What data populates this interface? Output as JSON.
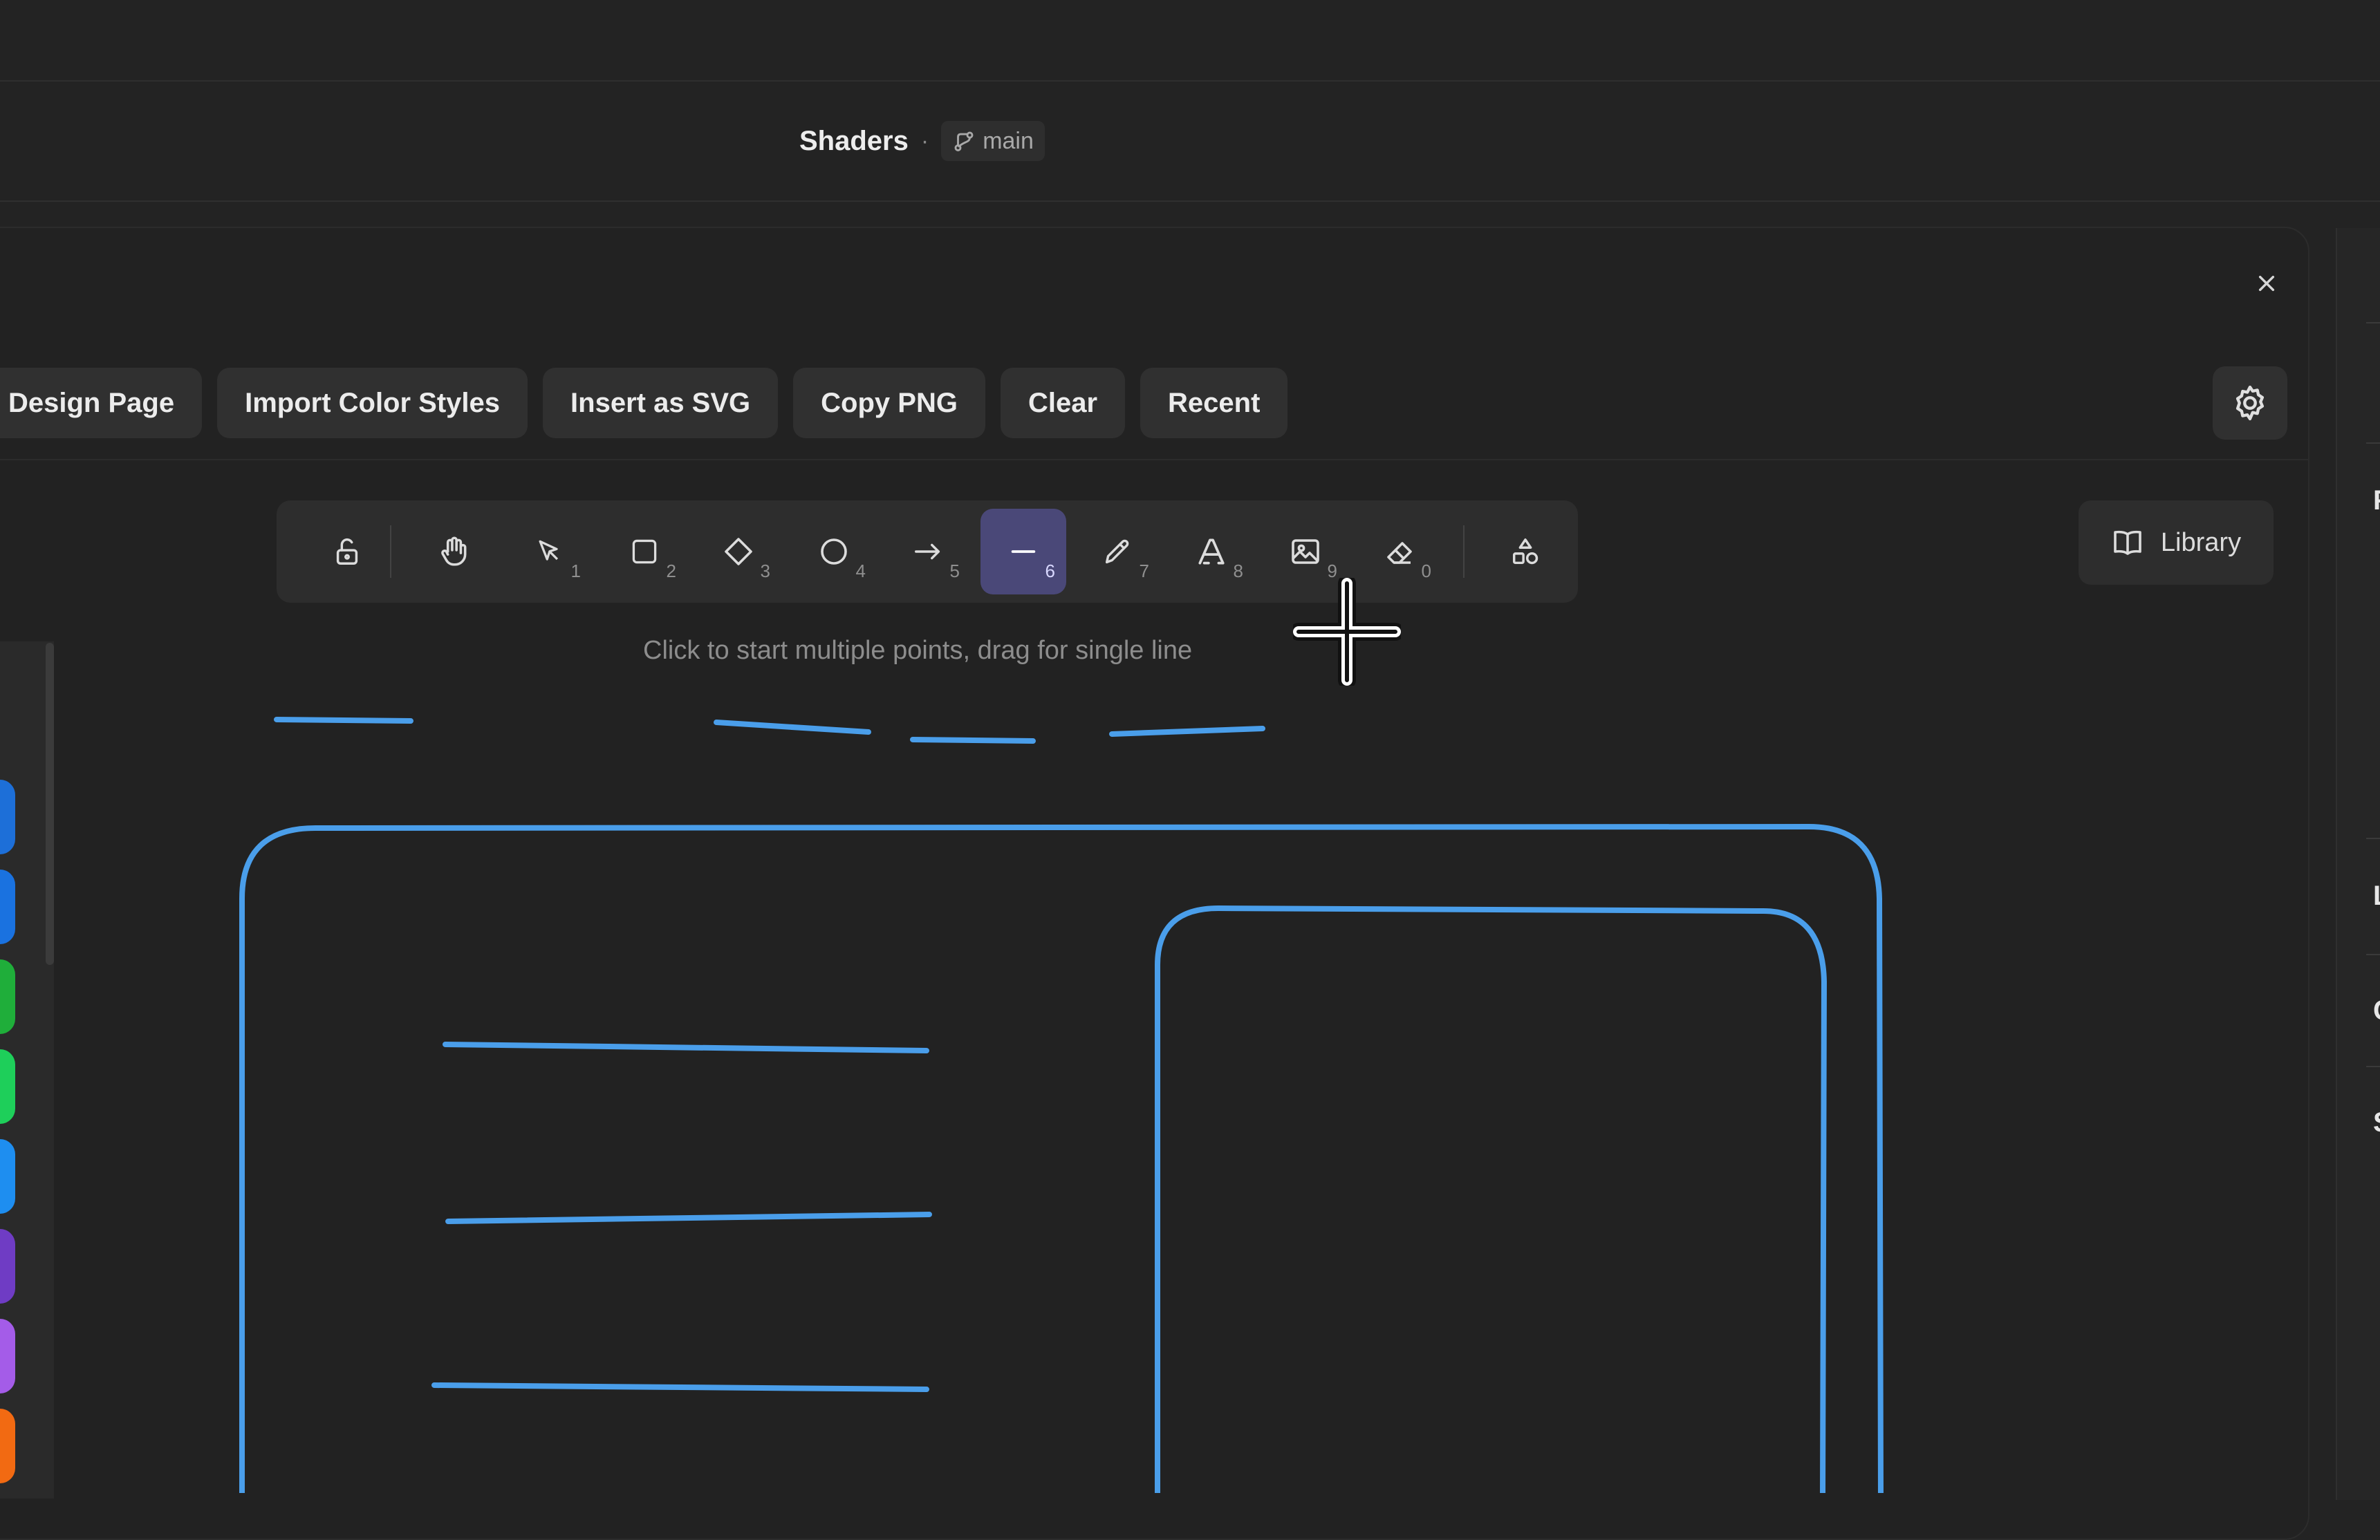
{
  "header": {
    "project_name": "Shaders",
    "separator": "·",
    "branch": "main"
  },
  "actions": [
    "Design Page",
    "Import Color Styles",
    "Insert as SVG",
    "Copy PNG",
    "Clear",
    "Recent"
  ],
  "toolbar": {
    "active_tool": "line",
    "tools": [
      {
        "name": "lock",
        "key": ""
      },
      {
        "name": "hand",
        "key": ""
      },
      {
        "name": "select",
        "key": "1"
      },
      {
        "name": "rectangle",
        "key": "2"
      },
      {
        "name": "diamond",
        "key": "3"
      },
      {
        "name": "ellipse",
        "key": "4"
      },
      {
        "name": "arrow",
        "key": "5"
      },
      {
        "name": "line",
        "key": "6"
      },
      {
        "name": "pencil",
        "key": "7"
      },
      {
        "name": "text",
        "key": "8"
      },
      {
        "name": "image",
        "key": "9"
      },
      {
        "name": "eraser",
        "key": "0"
      },
      {
        "name": "shapes",
        "key": ""
      }
    ]
  },
  "library": {
    "label": "Library"
  },
  "hint": "Click to start multiple points, drag for single line",
  "colors": {
    "stroke": "#4a9eea",
    "active_tool_bg": "#4a4878",
    "swatches": [
      "#1d6fd8",
      "#1a72e0",
      "#1fae3a",
      "#1ecf5a",
      "#1e8ef0",
      "#6f3cc4",
      "#a45ce8",
      "#f26a12"
    ]
  },
  "right_rail_letters": [
    "F",
    "L",
    "C",
    "S"
  ]
}
